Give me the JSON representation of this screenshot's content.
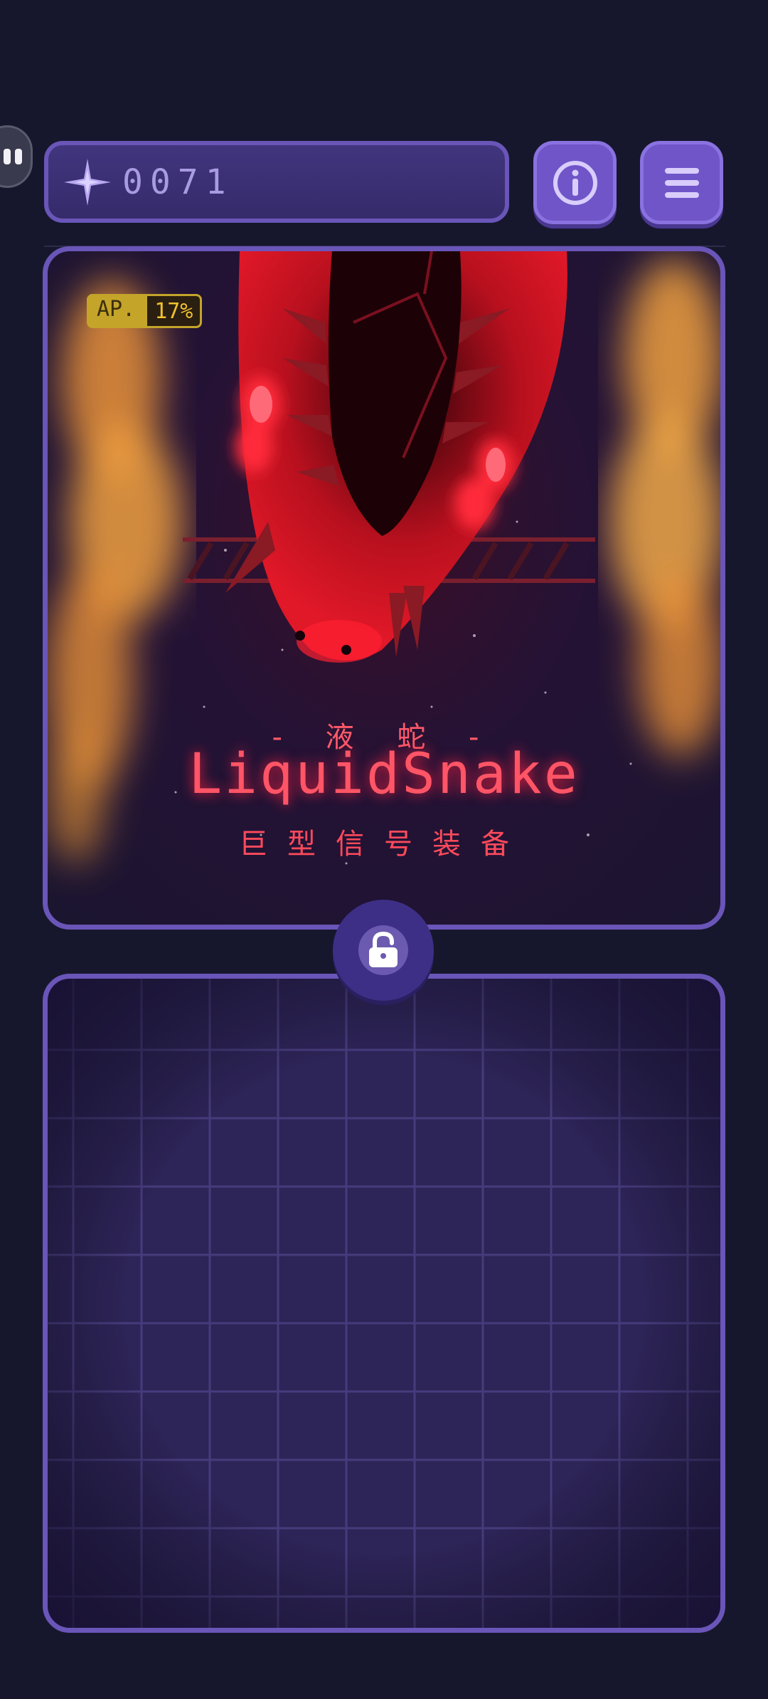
{
  "header": {
    "score": "0071",
    "score_icon": "compass-star-icon",
    "info_icon": "info-icon",
    "menu_icon": "hamburger-menu-icon"
  },
  "art": {
    "ap_label": "AP.",
    "ap_value": "17%",
    "cn_title": "- 液 蛇 -",
    "title": "LiquidSnake",
    "cn_subtitle": "巨型信号装备"
  },
  "lock_icon": "unlocked-padlock-icon",
  "colors": {
    "background": "#16172d",
    "panel_border": "#6a55b8",
    "button_fill": "#6f55c8",
    "title_red": "#ff5566",
    "grid_fill": "#2d2457"
  }
}
